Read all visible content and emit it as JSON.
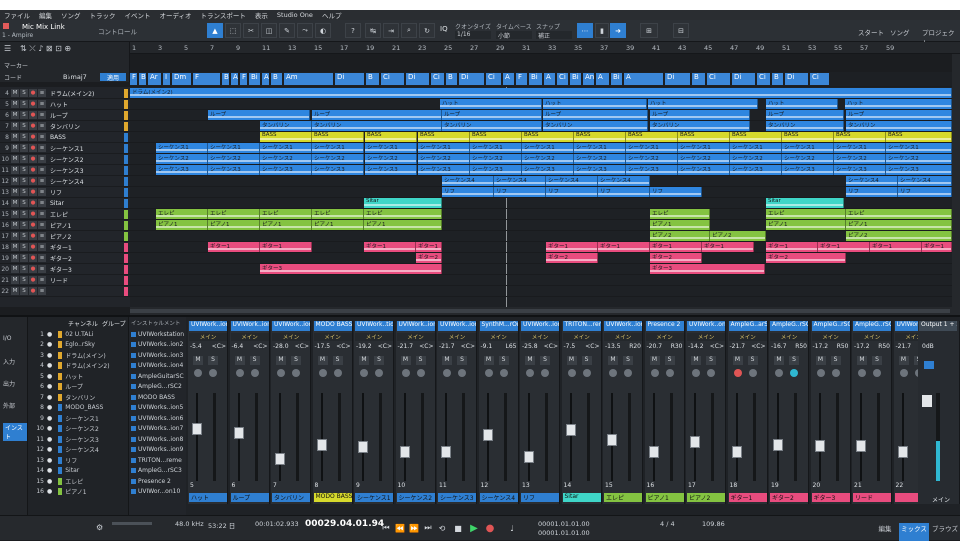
{
  "menubar": [
    "ファイル",
    "編集",
    "ソング",
    "トラック",
    "イベント",
    "オーディオ",
    "トランスポート",
    "表示",
    "Studio One",
    "ヘルプ"
  ],
  "toolbar": {
    "song_name": "Mic Mix Link",
    "song_sub": "1 - Ampire",
    "control_label": "コントロール",
    "quantize_label": "クオンタイズ",
    "quantize_value": "1/16",
    "timebase_label": "タイムベース",
    "timebase_value": "小節",
    "snap_label": "スナップ",
    "snap_value": "補正",
    "start_label": "スタート",
    "song_label": "ソング",
    "project_label": "プロジェクト"
  },
  "left_header": {
    "marker_label": "マーカー",
    "code_label": "コード",
    "key_value": "B♭maj7",
    "key_button": "適用"
  },
  "ruler": [
    "1",
    "3",
    "5",
    "7",
    "9",
    "11",
    "13",
    "15",
    "17",
    "19",
    "21",
    "23",
    "25",
    "27",
    "29",
    "31",
    "33",
    "35",
    "37",
    "39",
    "41",
    "43",
    "45",
    "47",
    "49",
    "51",
    "53",
    "55",
    "57",
    "59"
  ],
  "chords": [
    {
      "label": "F",
      "w": 8
    },
    {
      "label": "B",
      "w": 8
    },
    {
      "label": "Ar",
      "w": 14
    },
    {
      "label": "I",
      "w": 8
    },
    {
      "label": "Dm",
      "w": 20
    },
    {
      "label": "F",
      "w": 28
    },
    {
      "label": "B",
      "w": 8
    },
    {
      "label": "Ar",
      "w": 8
    },
    {
      "label": "F",
      "w": 8
    },
    {
      "label": "Bi",
      "w": 12
    },
    {
      "label": "A",
      "w": 8
    },
    {
      "label": "B",
      "w": 12
    },
    {
      "label": "Am",
      "w": 50
    },
    {
      "label": "Di",
      "w": 30
    },
    {
      "label": "B",
      "w": 14
    },
    {
      "label": "Ci",
      "w": 24
    },
    {
      "label": "Di",
      "w": 24
    },
    {
      "label": "Ci",
      "w": 14
    },
    {
      "label": "B",
      "w": 12
    },
    {
      "label": "Di",
      "w": 26
    },
    {
      "label": "Ci",
      "w": 16
    },
    {
      "label": "A",
      "w": 12
    },
    {
      "label": "F",
      "w": 12
    },
    {
      "label": "Bi",
      "w": 14
    },
    {
      "label": "A",
      "w": 12
    },
    {
      "label": "Ci",
      "w": 12
    },
    {
      "label": "Bi",
      "w": 12
    },
    {
      "label": "An",
      "w": 12
    },
    {
      "label": "A",
      "w": 14
    },
    {
      "label": "Bi",
      "w": 12
    },
    {
      "label": "A",
      "w": 40
    },
    {
      "label": "Di",
      "w": 26
    },
    {
      "label": "B",
      "w": 14
    },
    {
      "label": "Ci",
      "w": 24
    },
    {
      "label": "Di",
      "w": 24
    },
    {
      "label": "Ci",
      "w": 14
    },
    {
      "label": "B",
      "w": 12
    },
    {
      "label": "Di",
      "w": 24
    },
    {
      "label": "Ci",
      "w": 20
    }
  ],
  "tracks": [
    {
      "num": "4",
      "name": "ドラム(メイン2)",
      "color": "#e0a82e"
    },
    {
      "num": "5",
      "name": "ハット",
      "color": "#e0a82e"
    },
    {
      "num": "6",
      "name": "ループ",
      "color": "#e0a82e"
    },
    {
      "num": "7",
      "name": "タンバリン",
      "color": "#e0a82e"
    },
    {
      "num": "8",
      "name": "BASS",
      "color": "#2f7fd1"
    },
    {
      "num": "9",
      "name": "シーケンス1",
      "color": "#2f7fd1"
    },
    {
      "num": "10",
      "name": "シーケンス2",
      "color": "#2f7fd1"
    },
    {
      "num": "11",
      "name": "シーケンス3",
      "color": "#2f7fd1"
    },
    {
      "num": "12",
      "name": "シーケンス4",
      "color": "#2f7fd1"
    },
    {
      "num": "13",
      "name": "リフ",
      "color": "#2f7fd1"
    },
    {
      "num": "14",
      "name": "Sitar",
      "color": "#2f7fd1"
    },
    {
      "num": "15",
      "name": "エレピ",
      "color": "#84c341"
    },
    {
      "num": "16",
      "name": "ピアノ1",
      "color": "#84c341"
    },
    {
      "num": "17",
      "name": "ピアノ2",
      "color": "#84c341"
    },
    {
      "num": "18",
      "name": "ギター1",
      "color": "#e84c7e"
    },
    {
      "num": "19",
      "name": "ギター2",
      "color": "#e84c7e"
    },
    {
      "num": "20",
      "name": "ギター3",
      "color": "#e84c7e"
    },
    {
      "num": "21",
      "name": "リード",
      "color": "#e84c7e"
    },
    {
      "num": "22",
      "name": "",
      "color": "#e84c7e"
    }
  ],
  "lanes": [
    {
      "color": "#2f86e0",
      "clips": [
        [
          0,
          822,
          "ドラム(メイン2)"
        ]
      ]
    },
    {
      "color": "#2f86e0",
      "clips": [
        [
          310,
          102,
          "ハット"
        ],
        [
          413,
          104,
          "ハット"
        ],
        [
          518,
          110,
          "ハット"
        ],
        [
          636,
          72,
          "ハット"
        ],
        [
          715,
          107,
          "ハット"
        ]
      ]
    },
    {
      "color": "#2f86e0",
      "clips": [
        [
          78,
          102,
          "ループ"
        ],
        [
          182,
          130,
          "ループ"
        ],
        [
          312,
          100,
          "ループ"
        ],
        [
          413,
          105,
          "ループ"
        ],
        [
          520,
          100,
          "ループ"
        ],
        [
          636,
          78,
          "ループ"
        ],
        [
          716,
          106,
          "ループ"
        ]
      ]
    },
    {
      "color": "#2f86e0",
      "clips": [
        [
          130,
          52,
          "タンバリン"
        ],
        [
          182,
          130,
          "タンバリン"
        ],
        [
          312,
          100,
          "タンバリン"
        ],
        [
          413,
          105,
          "タンバリン"
        ],
        [
          520,
          100,
          "タンバリン"
        ],
        [
          636,
          78,
          "タンバリン"
        ],
        [
          716,
          106,
          "タンバリン"
        ]
      ]
    },
    {
      "color": "#d6d92c",
      "clips": [
        [
          130,
          52,
          "BASS"
        ],
        [
          182,
          52,
          "BASS"
        ],
        [
          235,
          52,
          "BASS"
        ],
        [
          288,
          52,
          "BASS"
        ],
        [
          340,
          52,
          "BASS"
        ],
        [
          392,
          52,
          "BASS"
        ],
        [
          444,
          52,
          "BASS"
        ],
        [
          496,
          52,
          "BASS"
        ],
        [
          548,
          52,
          "BASS"
        ],
        [
          600,
          52,
          "BASS"
        ],
        [
          652,
          52,
          "BASS"
        ],
        [
          704,
          52,
          "BASS"
        ],
        [
          756,
          66,
          "BASS"
        ]
      ]
    },
    {
      "color": "#2f86e0",
      "clips": [
        [
          26,
          52,
          "シーケンス1"
        ],
        [
          78,
          52,
          "シーケンス1"
        ],
        [
          130,
          52,
          "シーケンス1"
        ],
        [
          182,
          52,
          "シーケンス1"
        ],
        [
          235,
          52,
          "シーケンス1"
        ],
        [
          288,
          52,
          "シーケンス1"
        ],
        [
          340,
          52,
          "シーケンス1"
        ],
        [
          392,
          52,
          "シーケンス1"
        ],
        [
          444,
          52,
          "シーケンス1"
        ],
        [
          496,
          52,
          "シーケンス1"
        ],
        [
          548,
          52,
          "シーケンス1"
        ],
        [
          600,
          52,
          "シーケンス1"
        ],
        [
          652,
          52,
          "シーケンス1"
        ],
        [
          704,
          52,
          "シーケンス1"
        ],
        [
          756,
          66,
          "シーケンス1"
        ]
      ]
    },
    {
      "color": "#2f86e0",
      "clips": [
        [
          26,
          52,
          "シーケンス2"
        ],
        [
          78,
          52,
          "シーケンス2"
        ],
        [
          130,
          52,
          "シーケンス2"
        ],
        [
          182,
          52,
          "シーケンス2"
        ],
        [
          235,
          52,
          "シーケンス2"
        ],
        [
          288,
          52,
          "シーケンス2"
        ],
        [
          340,
          52,
          "シーケンス2"
        ],
        [
          392,
          52,
          "シーケンス2"
        ],
        [
          444,
          52,
          "シーケンス2"
        ],
        [
          496,
          52,
          "シーケンス2"
        ],
        [
          548,
          52,
          "シーケンス2"
        ],
        [
          600,
          52,
          "シーケンス2"
        ],
        [
          652,
          52,
          "シーケンス2"
        ],
        [
          704,
          52,
          "シーケンス2"
        ],
        [
          756,
          66,
          "シーケンス2"
        ]
      ]
    },
    {
      "color": "#2f86e0",
      "clips": [
        [
          26,
          52,
          "シーケンス3"
        ],
        [
          78,
          52,
          "シーケンス3"
        ],
        [
          130,
          52,
          "シーケンス3"
        ],
        [
          182,
          52,
          "シーケンス3"
        ],
        [
          235,
          52,
          "シーケンス3"
        ],
        [
          288,
          52,
          "シーケンス3"
        ],
        [
          340,
          52,
          "シーケンス3"
        ],
        [
          392,
          52,
          "シーケンス3"
        ],
        [
          444,
          52,
          "シーケンス3"
        ],
        [
          496,
          52,
          "シーケンス3"
        ],
        [
          548,
          52,
          "シーケンス3"
        ],
        [
          600,
          52,
          "シーケンス3"
        ],
        [
          652,
          52,
          "シーケンス3"
        ],
        [
          704,
          52,
          "シーケンス3"
        ],
        [
          756,
          66,
          "シーケンス3"
        ]
      ]
    },
    {
      "color": "#2f86e0",
      "clips": [
        [
          312,
          52,
          "シーケンス4"
        ],
        [
          364,
          52,
          "シーケンス4"
        ],
        [
          416,
          52,
          "シーケンス4"
        ],
        [
          468,
          52,
          "シーケンス4"
        ],
        [
          716,
          52,
          "シーケンス4"
        ],
        [
          768,
          54,
          "シーケンス4"
        ]
      ]
    },
    {
      "color": "#2f86e0",
      "clips": [
        [
          312,
          52,
          "リフ"
        ],
        [
          364,
          52,
          "リフ"
        ],
        [
          416,
          52,
          "リフ"
        ],
        [
          468,
          52,
          "リフ"
        ],
        [
          520,
          52,
          "リフ"
        ],
        [
          716,
          52,
          "リフ"
        ],
        [
          768,
          54,
          "リフ"
        ]
      ]
    },
    {
      "color": "#3fd6c8",
      "clips": [
        [
          234,
          78,
          "Sitar"
        ],
        [
          636,
          78,
          "Sitar"
        ]
      ]
    },
    {
      "color": "#84c341",
      "clips": [
        [
          26,
          52,
          "エレピ"
        ],
        [
          78,
          52,
          "エレピ"
        ],
        [
          130,
          52,
          "エレピ"
        ],
        [
          182,
          52,
          "エレピ"
        ],
        [
          234,
          78,
          "エレピ"
        ],
        [
          520,
          60,
          "エレピ"
        ],
        [
          636,
          80,
          "エレピ"
        ],
        [
          716,
          106,
          "エレピ"
        ]
      ]
    },
    {
      "color": "#84c341",
      "clips": [
        [
          26,
          52,
          "ピアノ1"
        ],
        [
          78,
          52,
          "ピアノ1"
        ],
        [
          130,
          52,
          "ピアノ1"
        ],
        [
          182,
          52,
          "ピアノ1"
        ],
        [
          234,
          78,
          "ピアノ1"
        ],
        [
          520,
          60,
          "ピアノ1"
        ],
        [
          636,
          80,
          "ピアノ1"
        ],
        [
          716,
          106,
          "ピアノ1"
        ]
      ]
    },
    {
      "color": "#84c341",
      "clips": [
        [
          520,
          60,
          "ピアノ2"
        ],
        [
          580,
          56,
          "ピアノ2"
        ],
        [
          716,
          106,
          "ピアノ2"
        ]
      ]
    },
    {
      "color": "#e84c7e",
      "clips": [
        [
          78,
          52,
          "ギター1"
        ],
        [
          130,
          52,
          "ギター1"
        ],
        [
          234,
          52,
          "ギター1"
        ],
        [
          286,
          26,
          "ギター1"
        ],
        [
          416,
          52,
          "ギター1"
        ],
        [
          468,
          52,
          "ギター1"
        ],
        [
          520,
          52,
          "ギター1"
        ],
        [
          572,
          52,
          "ギター1"
        ],
        [
          636,
          52,
          "ギター1"
        ],
        [
          688,
          52,
          "ギター1"
        ],
        [
          740,
          52,
          "ギター1"
        ],
        [
          792,
          30,
          "ギター1"
        ]
      ]
    },
    {
      "color": "#e84c7e",
      "clips": [
        [
          286,
          26,
          "ギター2"
        ],
        [
          416,
          52,
          "ギター2"
        ],
        [
          520,
          52,
          "ギター2"
        ],
        [
          636,
          80,
          "ギター2"
        ]
      ]
    },
    {
      "color": "#e84c7e",
      "clips": [
        [
          130,
          182,
          "ギター3"
        ],
        [
          520,
          115,
          "ギター3"
        ]
      ]
    },
    {
      "color": "#1e2125",
      "clips": []
    },
    {
      "color": "#1e2125",
      "clips": []
    }
  ],
  "console_left": [
    "I/O",
    "入力",
    "出力",
    "外部",
    "インスト"
  ],
  "chan_list_header": {
    "channel": "チャンネル",
    "group": "グループ"
  },
  "chan_list": [
    {
      "n": "1",
      "name": "02 U.TALi"
    },
    {
      "n": "2",
      "name": "Eglo..rSky"
    },
    {
      "n": "3",
      "name": "ドラム(メイン)"
    },
    {
      "n": "4",
      "name": "ドラム(メイン2)"
    },
    {
      "n": "5",
      "name": "ハット"
    },
    {
      "n": "6",
      "name": "ループ"
    },
    {
      "n": "7",
      "name": "タンバリン"
    },
    {
      "n": "8",
      "name": "MODO_BASS"
    },
    {
      "n": "9",
      "name": "シーケンス1"
    },
    {
      "n": "10",
      "name": "シーケンス2"
    },
    {
      "n": "11",
      "name": "シーケンス3"
    },
    {
      "n": "12",
      "name": "シーケンス4"
    },
    {
      "n": "13",
      "name": "リフ"
    },
    {
      "n": "14",
      "name": "Sitar"
    },
    {
      "n": "15",
      "name": "エレピ"
    },
    {
      "n": "16",
      "name": "ピアノ1"
    }
  ],
  "inst_list_header": "インストゥルメント",
  "inst_list": [
    "UVIWorkstation",
    "UVIWorks..ion2",
    "UVIWorks..ion3",
    "UVIWorks..ion4",
    "AmpleGuitarSC",
    "AmpleG...rSC2",
    "MODO BASS",
    "UVIWorks..ion5",
    "UVIWorks..ion6",
    "UVIWorks..ion7",
    "UVIWorks..ion8",
    "UVIWorks..ion9",
    "TRITON...reme",
    "AmpleG...rSC3",
    "Presence 2",
    "UVIWor...on10"
  ],
  "strips": [
    {
      "name": "UVIWork..ion8",
      "vol": "-5.4",
      "pan": "<C>",
      "num": "5",
      "label": "ハット",
      "lc": "#2f7fd1",
      "cap": 25
    },
    {
      "name": "UVIWork..ion5",
      "vol": "-6.4",
      "pan": "<C>",
      "num": "6",
      "label": "ループ",
      "lc": "#2f7fd1",
      "cap": 28
    },
    {
      "name": "UVIWork..ion9",
      "vol": "-28.0",
      "pan": "<C>",
      "num": "7",
      "label": "タンバリン",
      "lc": "#2f7fd1",
      "cap": 50
    },
    {
      "name": "MODO BASS",
      "vol": "-17.5",
      "pan": "<C>",
      "num": "8",
      "label": "MODO BASS",
      "lc": "#d6d92c",
      "cap": 38
    },
    {
      "name": "UVIWork..tion",
      "vol": "-19.2",
      "pan": "<C>",
      "num": "9",
      "label": "シーケンス1",
      "lc": "#2f7fd1",
      "cap": 40
    },
    {
      "name": "UVIWork..ion2",
      "vol": "-21.7",
      "pan": "<C>",
      "num": "10",
      "label": "シーケンス2",
      "lc": "#2f7fd1",
      "cap": 44
    },
    {
      "name": "UVIWork..ion3",
      "vol": "-21.7",
      "pan": "<C>",
      "num": "11",
      "label": "シーケンス3",
      "lc": "#2f7fd1",
      "cap": 44
    },
    {
      "name": "SynthM...rOne",
      "vol": "-9.1",
      "pan": "L65",
      "num": "12",
      "label": "シーケンス4",
      "lc": "#2f7fd1",
      "cap": 30
    },
    {
      "name": "UVIWork..ion5",
      "vol": "-25.8",
      "pan": "<C>",
      "num": "13",
      "label": "リフ",
      "lc": "#2f7fd1",
      "cap": 48
    },
    {
      "name": "TRITON...reme",
      "vol": "-7.5",
      "pan": "<C>",
      "num": "14",
      "label": "Sitar",
      "lc": "#3fd6c8",
      "cap": 26
    },
    {
      "name": "UVIWork..ion4",
      "vol": "-13.5",
      "pan": "R20",
      "num": "15",
      "label": "エレピ",
      "lc": "#84c341",
      "cap": 34
    },
    {
      "name": "Presence 2",
      "vol": "-20.7",
      "pan": "R30",
      "num": "16",
      "label": "ピアノ1",
      "lc": "#84c341",
      "cap": 44
    },
    {
      "name": "UVIWork..on10",
      "vol": "-14.2",
      "pan": "<C>",
      "num": "17",
      "label": "ピアノ2",
      "lc": "#84c341",
      "cap": 36
    },
    {
      "name": "AmpleG..arSC",
      "vol": "-21.7",
      "pan": "<C>",
      "num": "18",
      "label": "ギター1",
      "lc": "#e84c7e",
      "cap": 44
    },
    {
      "name": "AmpleG..rSC3",
      "vol": "-16.7",
      "pan": "R50",
      "num": "19",
      "label": "ギター2",
      "lc": "#e84c7e",
      "cap": 38
    },
    {
      "name": "AmpleG..rSC2",
      "vol": "-17.2",
      "pan": "R50",
      "num": "20",
      "label": "ギター3",
      "lc": "#e84c7e",
      "cap": 39
    },
    {
      "name": "AmpleG..rSC4",
      "vol": "-17.2",
      "pan": "R50",
      "num": "21",
      "label": "リード",
      "lc": "#e84c7e",
      "cap": 39
    },
    {
      "name": "UVIWor",
      "vol": "-21.7",
      "pan": "",
      "num": "22",
      "label": "",
      "lc": "#e84c7e",
      "cap": 44
    }
  ],
  "strip_main_label": "メイン",
  "output": {
    "name": "Output 1 + 2",
    "vol": "0dB",
    "label": "メイン"
  },
  "transport": {
    "sample_rate": "48.0 kHz",
    "record_time": "53:22 日",
    "time": "00:01:02.933",
    "position": "00029.04.01.94",
    "left_loc": "00001.01.01.00",
    "right_loc": "00001.01.01.00",
    "signature": "4 / 4",
    "tempo": "109.86",
    "tabs": [
      "編集",
      "ミックス",
      "ブラウズ"
    ]
  },
  "colors": {
    "accent": "#2f7fd1",
    "bass": "#d6d92c",
    "keys": "#84c341",
    "guitar": "#e84c7e",
    "sitar": "#3fd6c8",
    "chord": "#3b87d8"
  }
}
